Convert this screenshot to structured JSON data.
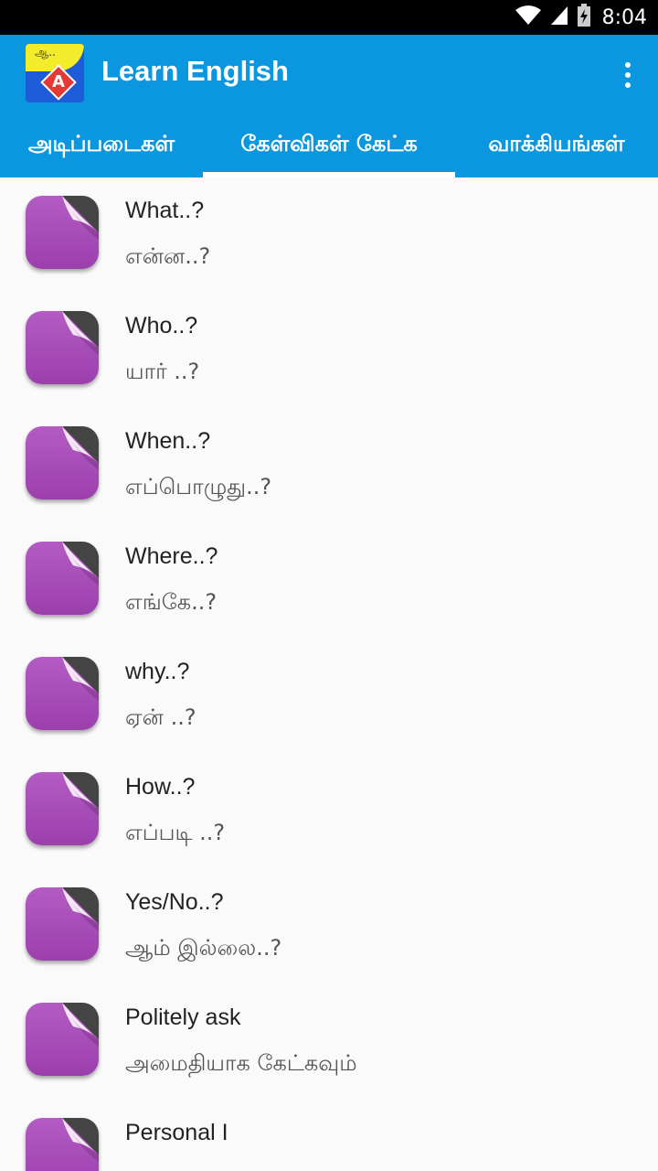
{
  "status_bar": {
    "time": "8:04",
    "icons": [
      "wifi-icon",
      "signal-icon",
      "battery-charging-icon"
    ]
  },
  "app_bar": {
    "title": "Learn English",
    "logo_text": "ஆ..",
    "logo_letter": "A",
    "menu_icon": "overflow-menu-icon"
  },
  "tabs": [
    {
      "label": "அடிப்படைகள்",
      "selected": false
    },
    {
      "label": "கேள்விகள் கேட்க",
      "selected": true
    },
    {
      "label": "வாக்கியங்கள்",
      "selected": false
    }
  ],
  "items": [
    {
      "title": "What..?",
      "subtitle": "என்ன..?"
    },
    {
      "title": "Who..?",
      "subtitle": "யார் ..?"
    },
    {
      "title": "When..?",
      "subtitle": "எப்பொழுது..?"
    },
    {
      "title": "Where..?",
      "subtitle": "எங்கே..?"
    },
    {
      "title": "why..?",
      "subtitle": "ஏன் ..?"
    },
    {
      "title": "How..?",
      "subtitle": "எப்படி ..?"
    },
    {
      "title": "Yes/No..?",
      "subtitle": "ஆம் இல்லை..?"
    },
    {
      "title": "Politely ask",
      "subtitle": "அமைதியாக கேட்கவும்"
    },
    {
      "title": "Personal I",
      "subtitle": ""
    }
  ],
  "colors": {
    "app_bar": "#0a97e0",
    "item_icon": "#a64bb8",
    "background": "#fafafa"
  }
}
